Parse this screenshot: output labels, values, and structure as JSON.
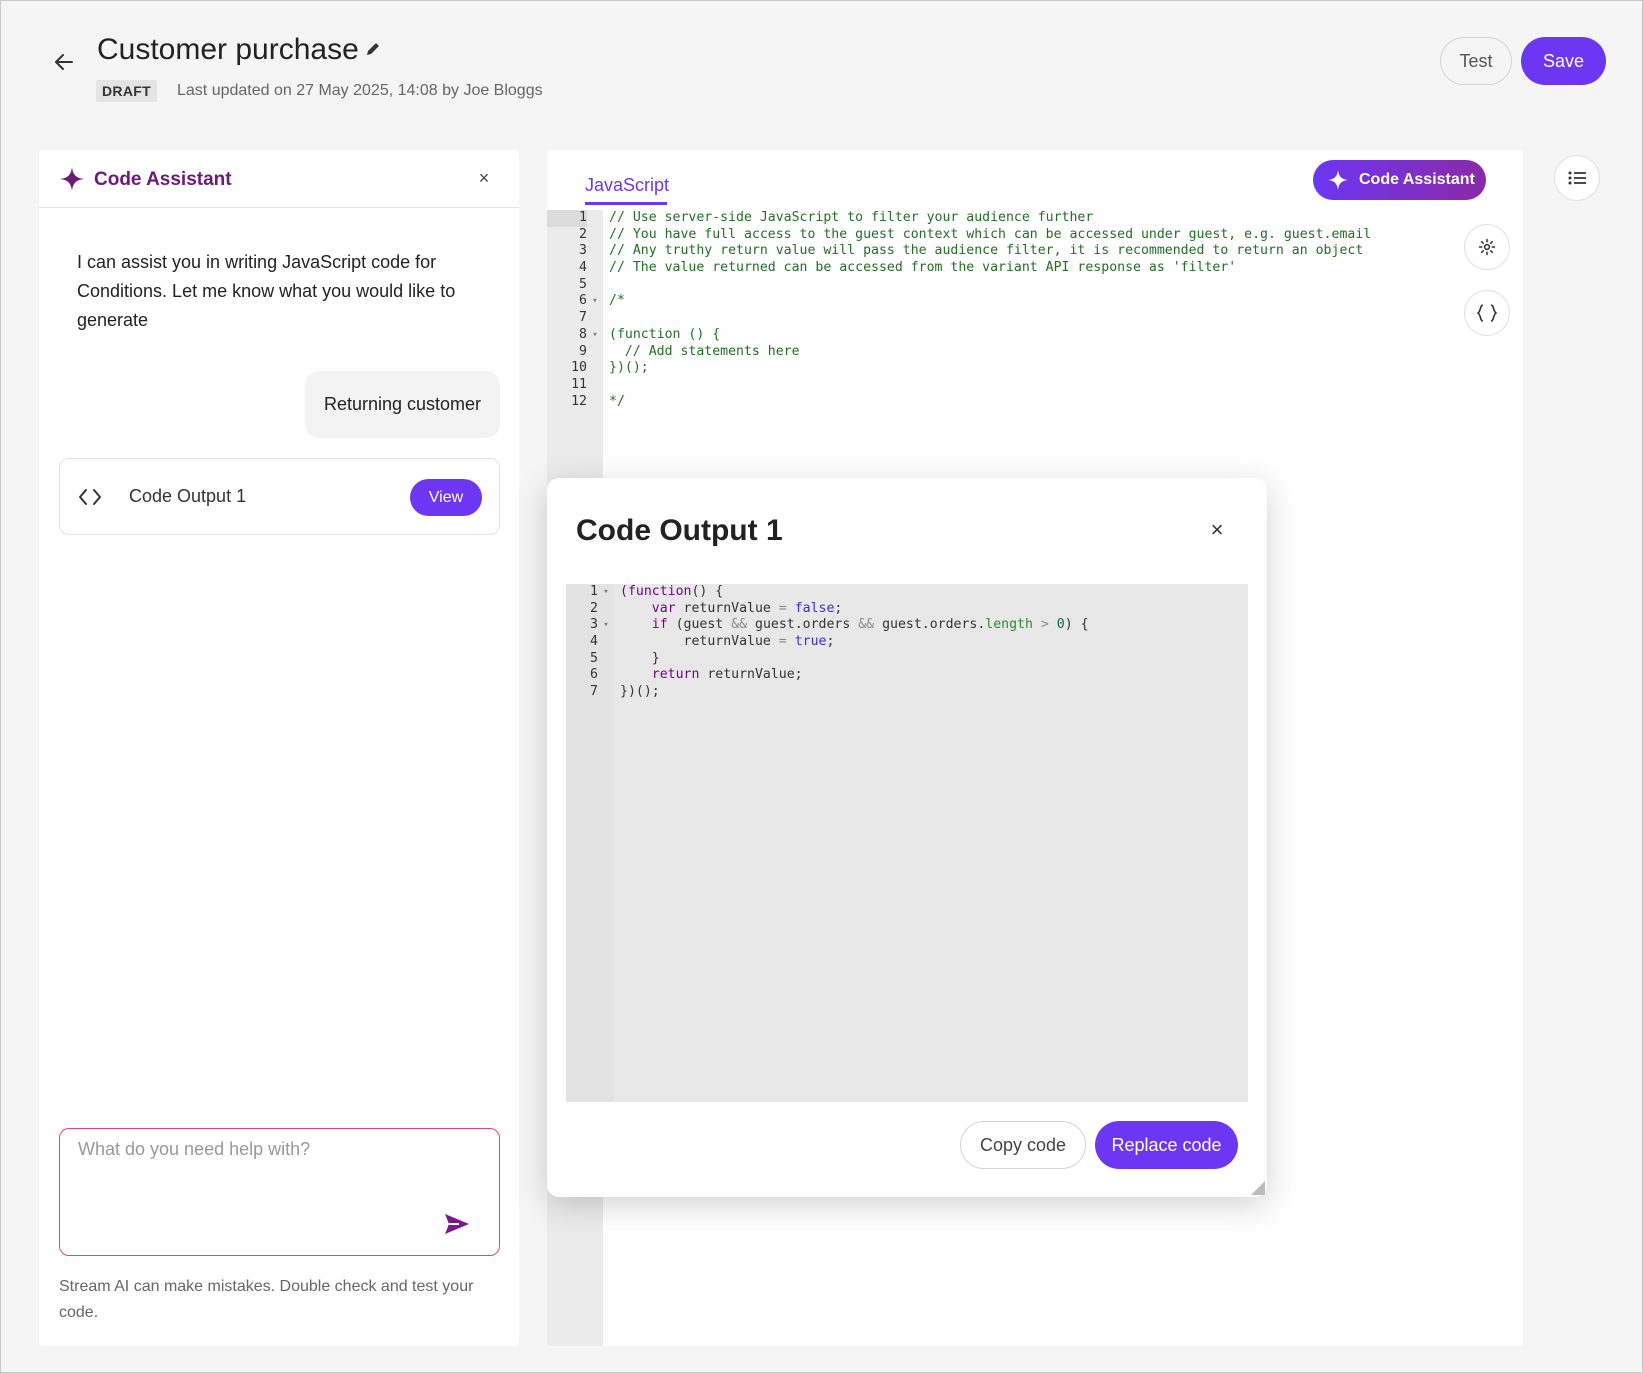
{
  "header": {
    "title": "Customer purchase",
    "status_badge": "DRAFT",
    "updated_text": "Last updated on 27 May 2025, 14:08 by Joe Bloggs",
    "test_label": "Test",
    "save_label": "Save"
  },
  "assistant": {
    "title": "Code Assistant",
    "close_glyph": "×",
    "intro_message": "I can assist you in writing JavaScript code for Conditions. Let me know what you would like to generate",
    "user_message": "Returning customer",
    "output_card_label": "Code Output 1",
    "view_label": "View",
    "prompt_placeholder": "What do you need help with?",
    "disclaimer": "Stream AI can make mistakes. Double check and test your code."
  },
  "editor": {
    "tab_label": "JavaScript",
    "assistant_button_label": "Code Assistant",
    "lines": [
      {
        "n": "1",
        "fold": "",
        "text": "// Use server-side JavaScript to filter your audience further",
        "kind": "cmt"
      },
      {
        "n": "2",
        "fold": "",
        "text": "// You have full access to the guest context which can be accessed under guest, e.g. guest.email",
        "kind": "cmt"
      },
      {
        "n": "3",
        "fold": "",
        "text": "// Any truthy return value will pass the audience filter, it is recommended to return an object",
        "kind": "cmt"
      },
      {
        "n": "4",
        "fold": "",
        "text": "// The value returned can be accessed from the variant API response as 'filter'",
        "kind": "cmt"
      },
      {
        "n": "5",
        "fold": "",
        "text": "",
        "kind": "cmt"
      },
      {
        "n": "6",
        "fold": "▾",
        "text": "/*",
        "kind": "cmt"
      },
      {
        "n": "7",
        "fold": "",
        "text": "",
        "kind": "cmt"
      },
      {
        "n": "8",
        "fold": "▾",
        "text": "(function () {",
        "kind": "cmt"
      },
      {
        "n": "9",
        "fold": "",
        "text": "  // Add statements here",
        "kind": "cmt"
      },
      {
        "n": "10",
        "fold": "",
        "text": "})();",
        "kind": "cmt"
      },
      {
        "n": "11",
        "fold": "",
        "text": "",
        "kind": "cmt"
      },
      {
        "n": "12",
        "fold": "",
        "text": "*/",
        "kind": "cmt"
      }
    ]
  },
  "modal": {
    "title": "Code Output 1",
    "close_glyph": "×",
    "copy_label": "Copy code",
    "replace_label": "Replace code",
    "lines": [
      {
        "n": "1",
        "fold": "▾",
        "tokens": [
          [
            "kw",
            "(function"
          ],
          [
            "",
            "() {"
          ]
        ]
      },
      {
        "n": "2",
        "fold": "",
        "tokens": [
          [
            "",
            "    "
          ],
          [
            "kw",
            "var"
          ],
          [
            "",
            " returnValue "
          ],
          [
            "op",
            "="
          ],
          [
            "",
            " "
          ],
          [
            "bool",
            "false"
          ],
          [
            "",
            ";"
          ]
        ]
      },
      {
        "n": "3",
        "fold": "▾",
        "tokens": [
          [
            "",
            "    "
          ],
          [
            "kw",
            "if"
          ],
          [
            "",
            " (guest "
          ],
          [
            "op",
            "&&"
          ],
          [
            "",
            " guest.orders "
          ],
          [
            "op",
            "&&"
          ],
          [
            "",
            " guest.orders."
          ],
          [
            "prop",
            "length"
          ],
          [
            "",
            " "
          ],
          [
            "op",
            ">"
          ],
          [
            "",
            " "
          ],
          [
            "num",
            "0"
          ],
          [
            "",
            ") {"
          ]
        ]
      },
      {
        "n": "4",
        "fold": "",
        "tokens": [
          [
            "",
            "        returnValue "
          ],
          [
            "op",
            "="
          ],
          [
            "",
            " "
          ],
          [
            "bool",
            "true"
          ],
          [
            "",
            ";"
          ]
        ]
      },
      {
        "n": "5",
        "fold": "",
        "tokens": [
          [
            "",
            "    }"
          ]
        ]
      },
      {
        "n": "6",
        "fold": "",
        "tokens": [
          [
            "",
            "    "
          ],
          [
            "kw",
            "return"
          ],
          [
            "",
            " returnValue;"
          ]
        ]
      },
      {
        "n": "7",
        "fold": "",
        "tokens": [
          [
            "",
            "})();"
          ]
        ]
      }
    ]
  },
  "icons": {
    "back": "arrow-left-icon",
    "edit": "pencil-icon",
    "sparkle": "sparkle-icon",
    "code": "code-brackets-icon",
    "send": "send-icon",
    "settings": "gear-icon",
    "braces": "braces-icon",
    "list": "list-icon"
  },
  "colors": {
    "accent": "#6c36f2",
    "assistant_title": "#6c1a7a",
    "comment": "#236e25"
  }
}
